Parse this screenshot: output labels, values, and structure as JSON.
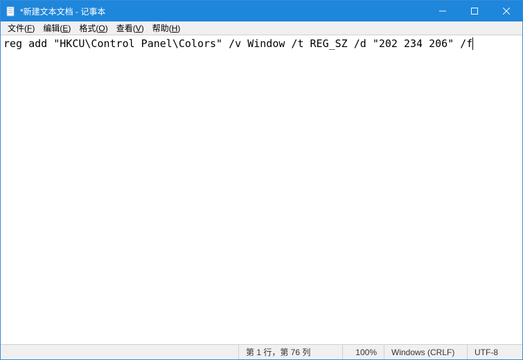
{
  "titlebar": {
    "title": "*新建文本文档 - 记事本"
  },
  "menu": {
    "file": {
      "label": "文件(",
      "accel": "F",
      "tail": ")"
    },
    "edit": {
      "label": "编辑(",
      "accel": "E",
      "tail": ")"
    },
    "format": {
      "label": "格式(",
      "accel": "O",
      "tail": ")"
    },
    "view": {
      "label": "查看(",
      "accel": "V",
      "tail": ")"
    },
    "help": {
      "label": "帮助(",
      "accel": "H",
      "tail": ")"
    }
  },
  "editor": {
    "content": "reg add \"HKCU\\Control Panel\\Colors\" /v Window /t REG_SZ /d \"202 234 206\" /f"
  },
  "status": {
    "position": "第 1 行，第 76 列",
    "zoom": "100%",
    "eol": "Windows (CRLF)",
    "encoding": "UTF-8"
  }
}
